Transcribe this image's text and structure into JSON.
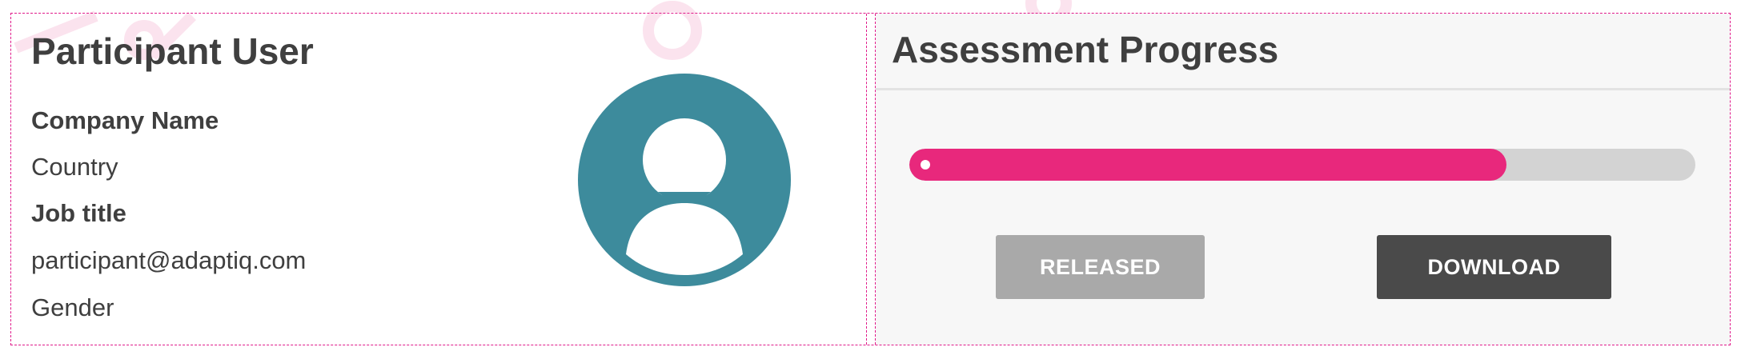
{
  "participant": {
    "name": "Participant User",
    "company": "Company Name",
    "country": "Country",
    "job_title": "Job title",
    "email": "participant@adaptiq.com",
    "gender": "Gender",
    "avatar_icon": "user-avatar-icon",
    "avatar_color": "#3d8b9c"
  },
  "assessment": {
    "title": "Assessment Progress",
    "progress_percent": 76,
    "progress_color": "#e8287c",
    "track_color": "#d3d3d3",
    "released_label": "RELEASED",
    "download_label": "DOWNLOAD"
  },
  "colors": {
    "accent": "#e0198a",
    "text": "#3f3f3f"
  }
}
